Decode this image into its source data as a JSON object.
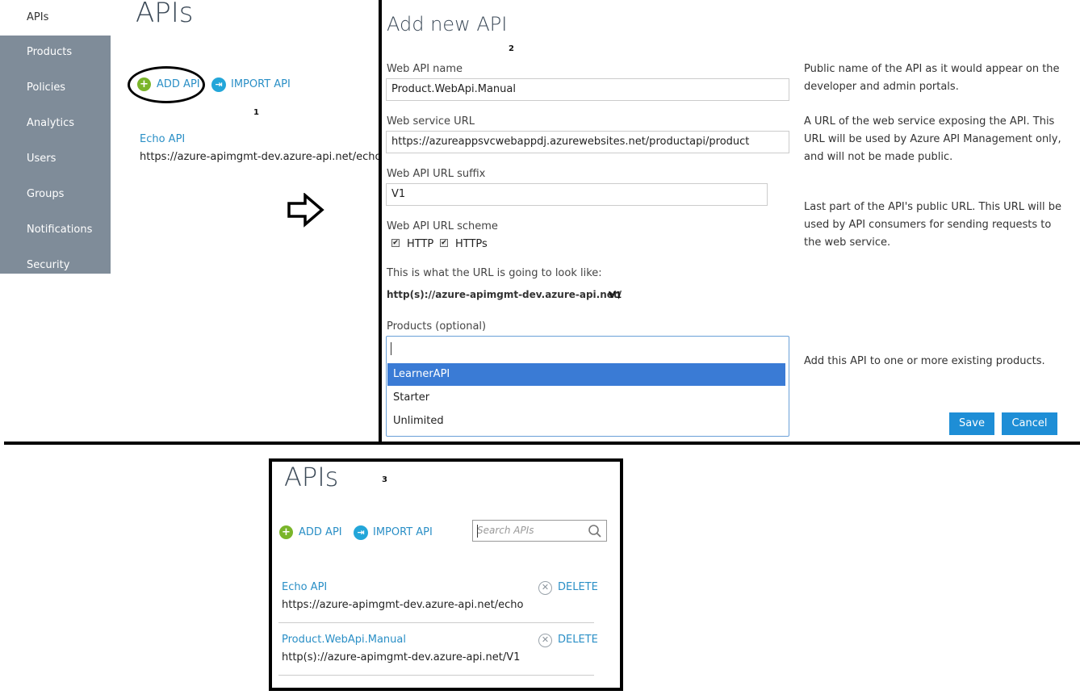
{
  "sidebar": {
    "items": [
      {
        "label": "APIs",
        "active": true
      },
      {
        "label": "Products"
      },
      {
        "label": "Policies"
      },
      {
        "label": "Analytics"
      },
      {
        "label": "Users"
      },
      {
        "label": "Groups"
      },
      {
        "label": "Notifications"
      },
      {
        "label": "Security"
      }
    ]
  },
  "panel1": {
    "title": "APIs",
    "add_api": "ADD API",
    "import_api": "IMPORT API",
    "step": "1",
    "api": {
      "name": "Echo API",
      "url": "https://azure-apimgmt-dev.azure-api.net/echo"
    }
  },
  "panel2": {
    "title": "Add new API",
    "step": "2",
    "web_api_name_label": "Web API name",
    "web_api_name_value": "Product.WebApi.Manual",
    "web_service_url_label": "Web service URL",
    "web_service_url_value": "https://azureappsvcwebappdj.azurewebsites.net/productapi/product",
    "suffix_label": "Web API URL suffix",
    "suffix_value": "V1",
    "scheme_label": "Web API URL scheme",
    "scheme_http": "HTTP",
    "scheme_https": "HTTPs",
    "url_preview_label": "This is what the URL is going to look like:",
    "url_preview_base": "http(s)://azure-apimgmt-dev.azure-api.net/",
    "url_preview_suffix": "V1",
    "products_label": "Products (optional)",
    "products_options": [
      "LearnerAPI",
      "Starter",
      "Unlimited"
    ],
    "help_name": "Public name of the API as it would appear on the developer and admin portals.",
    "help_url": "A URL of the web service exposing the API. This URL will be used by Azure API Management only, and will not be made public.",
    "help_suffix": "Last part of the API's public URL. This URL will be used by API consumers for sending requests to the web service.",
    "help_products": "Add this API to one or more existing products.",
    "save": "Save",
    "cancel": "Cancel"
  },
  "panel3": {
    "title": "APIs",
    "step": "3",
    "add_api": "ADD API",
    "import_api": "IMPORT API",
    "search_placeholder": "Search APIs",
    "delete": "DELETE",
    "apis": [
      {
        "name": "Echo API",
        "url": "https://azure-apimgmt-dev.azure-api.net/echo"
      },
      {
        "name": "Product.WebApi.Manual",
        "url": "http(s)://azure-apimgmt-dev.azure-api.net/V1"
      }
    ]
  },
  "colors": {
    "sidebar": "#7f8c99",
    "link": "#2a8fc6",
    "button": "#1e8ed6",
    "selected": "#3a7bd5",
    "add_icon": "#7ab52a",
    "import_icon": "#23a6d9"
  }
}
